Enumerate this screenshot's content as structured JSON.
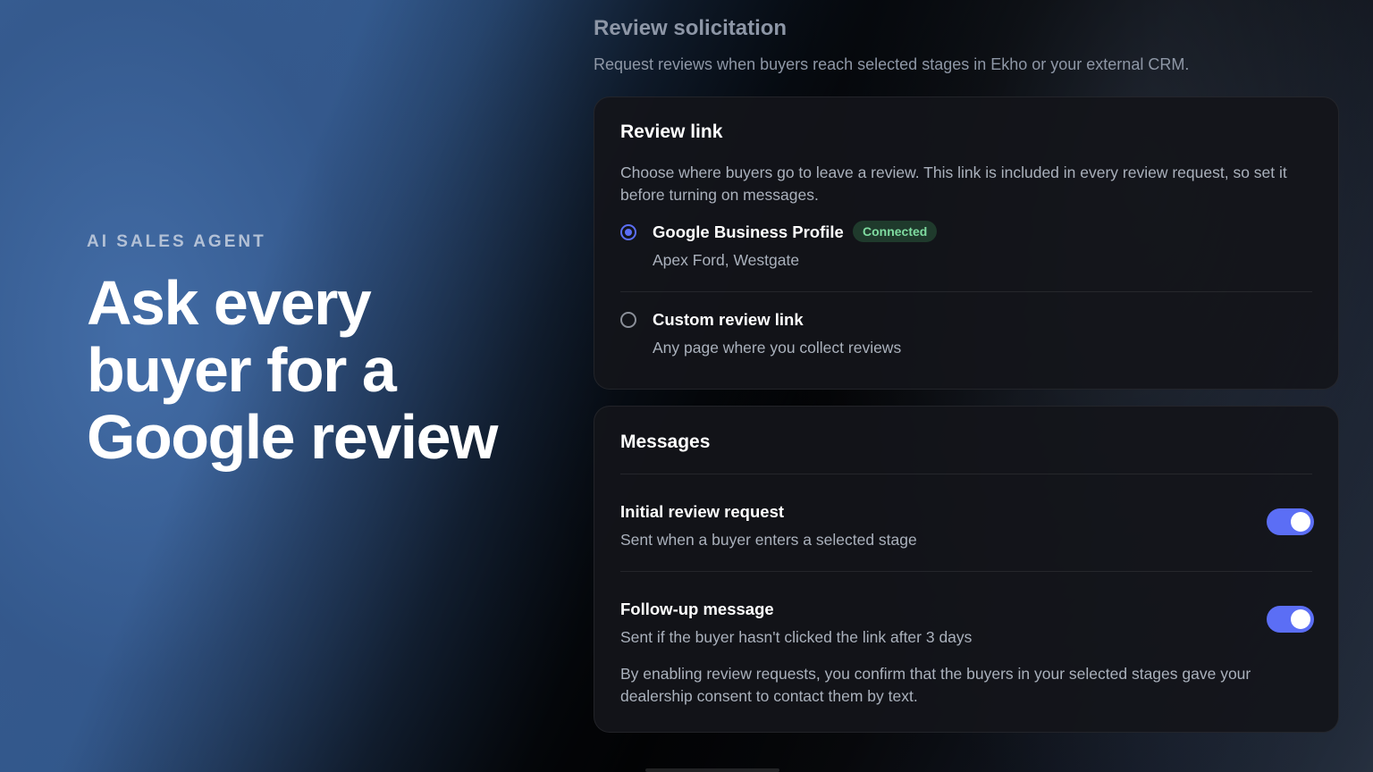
{
  "hero": {
    "eyebrow": "AI SALES AGENT",
    "headline": "Ask every buyer for a Google review"
  },
  "section": {
    "title": "Review solicitation",
    "subtitle": "Request reviews when buyers reach selected stages in Ekho or your external CRM."
  },
  "review_link": {
    "title": "Review link",
    "description": "Choose where buyers go to leave a review. This link is included in every review request, so set it before turning on messages.",
    "options": [
      {
        "label": "Google Business Profile",
        "badge": "Connected",
        "sub": "Apex Ford, Westgate",
        "selected": true
      },
      {
        "label": "Custom review link",
        "sub": "Any page where you collect reviews",
        "selected": false
      }
    ]
  },
  "messages": {
    "title": "Messages",
    "items": [
      {
        "title": "Initial review request",
        "sub": "Sent when a buyer enters a selected stage",
        "enabled": true
      },
      {
        "title": "Follow-up message",
        "sub": "Sent if the buyer hasn't clicked the link after 3 days",
        "enabled": true
      }
    ],
    "consent": "By enabling review requests, you confirm that the buyers in your selected stages gave your dealership consent to contact them by text."
  },
  "colors": {
    "accent": "#5b6ef5",
    "badge_bg": "#1f3a2c",
    "badge_text": "#7fdba0",
    "card_bg": "#14151a"
  },
  "icons": {
    "radio_selected": "radio-selected-icon",
    "radio_unselected": "radio-unselected-icon"
  }
}
